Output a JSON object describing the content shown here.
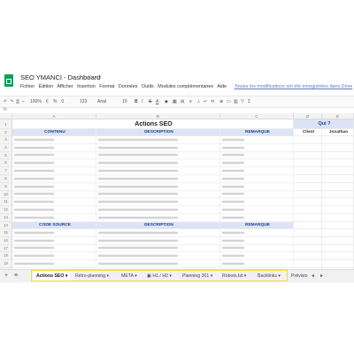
{
  "title": "SEO YMANCI - Dashboard",
  "menu": [
    "Fichier",
    "Édition",
    "Afficher",
    "Insertion",
    "Format",
    "Données",
    "Outils",
    "Modules complémentaires",
    "Aide"
  ],
  "saved_status": "Toutes les modifications ont été enregistrées dans Drive",
  "toolbar": {
    "zoom": "100%",
    "currency": "€",
    "percent": "%",
    "decimals": ".0",
    ".00": ".00",
    "format": "123",
    "font": "Arial",
    "size": "10"
  },
  "columns": [
    "A",
    "B",
    "C",
    "D",
    "E"
  ],
  "sheet_title": "Actions SEO",
  "qui": "Qui ?",
  "client": "Client",
  "jonathan": "Jonathan",
  "section1": {
    "contenu": "CONTENU",
    "description": "DESCRIPTION",
    "remarque": "REMARQUE"
  },
  "section2": {
    "code": "CODE SOURCE",
    "description": "DESCRIPTION",
    "remarque": "REMARQUE"
  },
  "rows": [
    "1",
    "2",
    "3",
    "4",
    "5",
    "6",
    "7",
    "8",
    "9",
    "10",
    "11",
    "12",
    "13",
    "14",
    "15",
    "16",
    "17",
    "18",
    "19",
    "20",
    "21",
    "22",
    "23"
  ],
  "tabs": [
    "Actions SEO",
    "Rétro-planning",
    "META",
    "H1 / H2",
    "Planning 301",
    "Robots.txt",
    "Backlinks",
    "Prévisio"
  ],
  "icons": {
    "add": "plus-icon",
    "list": "sheet-list-icon",
    "star": "star-icon",
    "folder": "folder-icon"
  }
}
